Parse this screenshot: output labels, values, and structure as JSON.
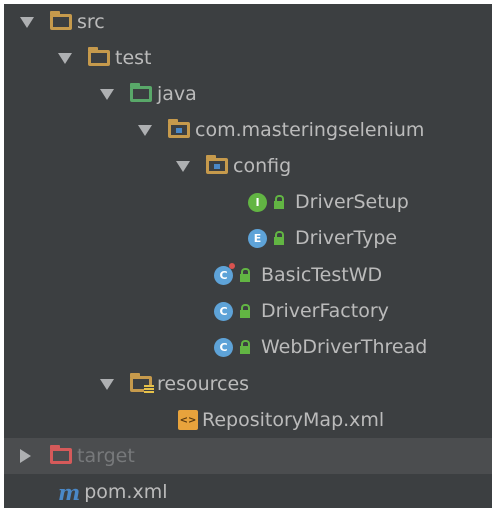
{
  "tree": {
    "src": "src",
    "test": "test",
    "java": "java",
    "package": "com.masteringselenium",
    "config": "config",
    "driver_setup": {
      "kind": "I",
      "label": "DriverSetup"
    },
    "driver_type": {
      "kind": "E",
      "label": "DriverType"
    },
    "basic_test_wd": {
      "kind": "C",
      "label": "BasicTestWD"
    },
    "driver_factory": {
      "kind": "C",
      "label": "DriverFactory"
    },
    "web_driver_thread": {
      "kind": "C",
      "label": "WebDriverThread"
    },
    "resources": "resources",
    "xml_icon": "<>",
    "repository_map": "RepositoryMap.xml",
    "target": "target",
    "pom_icon": "m",
    "pom": "pom.xml"
  },
  "colors": {
    "background": "#3c3f41",
    "selection": "#4b4d4f",
    "text": "#bbbbbb",
    "folder": "#c69a4c",
    "source_root": "#59a869",
    "excluded": "#d55a5a",
    "interface": "#62b543",
    "class": "#5ea3d8"
  }
}
